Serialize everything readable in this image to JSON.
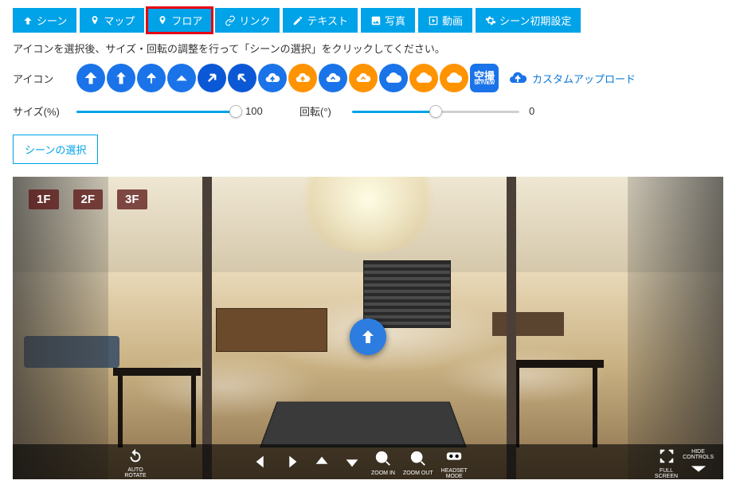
{
  "tabs": {
    "scene": "シーン",
    "map": "マップ",
    "floor": "フロア",
    "link": "リンク",
    "text": "テキスト",
    "photo": "写真",
    "video": "動画",
    "init": "シーン初期設定"
  },
  "instruction": "アイコンを選択後、サイズ・回転の調整を行って「シーンの選択」をクリックしてください。",
  "labels": {
    "icon": "アイコン",
    "size": "サイズ(%)",
    "rotation": "回転(°)",
    "custom_upload": "カスタムアップロード",
    "select_scene": "シーンの選択",
    "skyview_top": "空撮",
    "skyview_sub": "SKYVIEW"
  },
  "slider": {
    "size_value": "100",
    "size_fill_pct": 100,
    "rotation_value": "0",
    "rotation_knob_pct": 50
  },
  "floors": {
    "f1": "1F",
    "f2": "2F",
    "f3": "3F"
  },
  "viewer_controls": {
    "auto_rotate": "AUTO\nROTATE",
    "zoom_in": "ZOOM IN",
    "zoom_out": "ZOOM OUT",
    "headset": "HEADSET\nMODE",
    "full_screen": "FULL\nSCREEN",
    "hide_controls": "HIDE\nCONTROLS"
  }
}
